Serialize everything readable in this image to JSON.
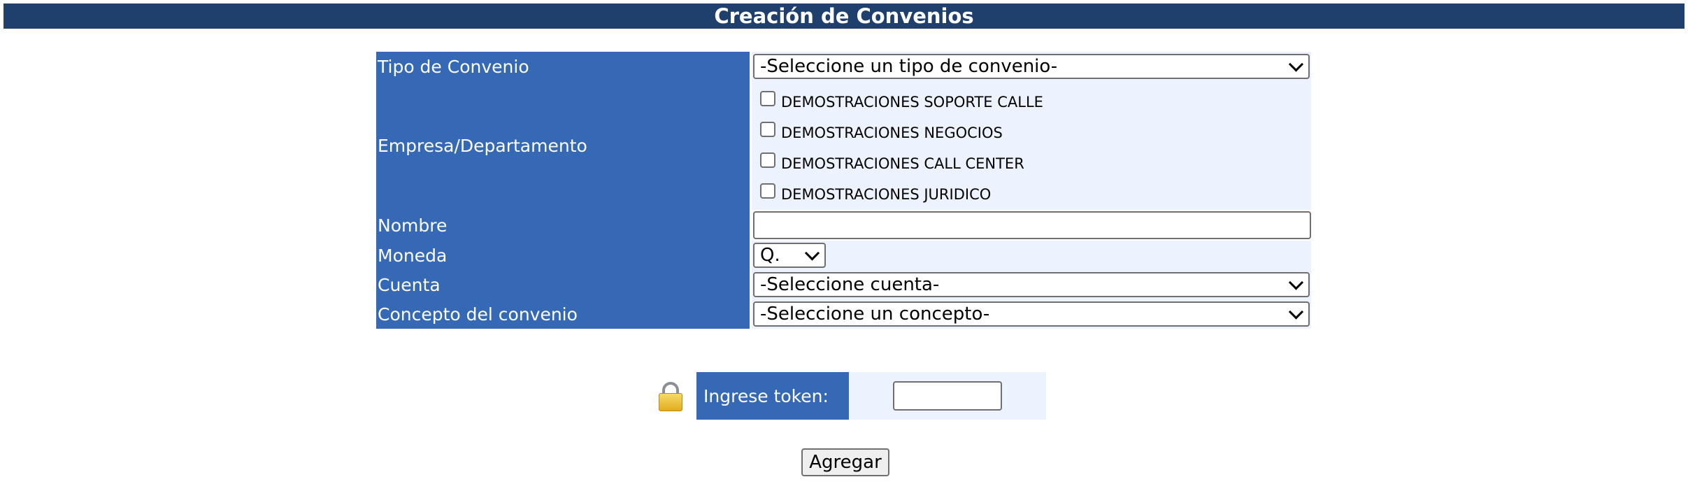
{
  "header": {
    "title": "Creación de Convenios"
  },
  "form": {
    "tipo_convenio": {
      "label": "Tipo de Convenio",
      "selected": "-Seleccione un tipo de convenio-"
    },
    "empresa": {
      "label": "Empresa/Departamento",
      "options": [
        {
          "label": "DEMOSTRACIONES SOPORTE CALLE",
          "checked": false
        },
        {
          "label": "DEMOSTRACIONES NEGOCIOS",
          "checked": false
        },
        {
          "label": "DEMOSTRACIONES CALL CENTER",
          "checked": false
        },
        {
          "label": "DEMOSTRACIONES JURIDICO",
          "checked": false
        }
      ]
    },
    "nombre": {
      "label": "Nombre",
      "value": ""
    },
    "moneda": {
      "label": "Moneda",
      "selected": "Q."
    },
    "cuenta": {
      "label": "Cuenta",
      "selected": "-Seleccione cuenta-"
    },
    "concepto": {
      "label": "Concepto del convenio",
      "selected": "-Seleccione un concepto-"
    }
  },
  "token": {
    "label": "Ingrese token:",
    "value": "",
    "icon": "lock-icon"
  },
  "actions": {
    "add_label": "Agregar"
  },
  "colors": {
    "header_bg": "#1f3f6d",
    "label_bg": "#3569b5",
    "value_bg": "#ecf3fe"
  }
}
